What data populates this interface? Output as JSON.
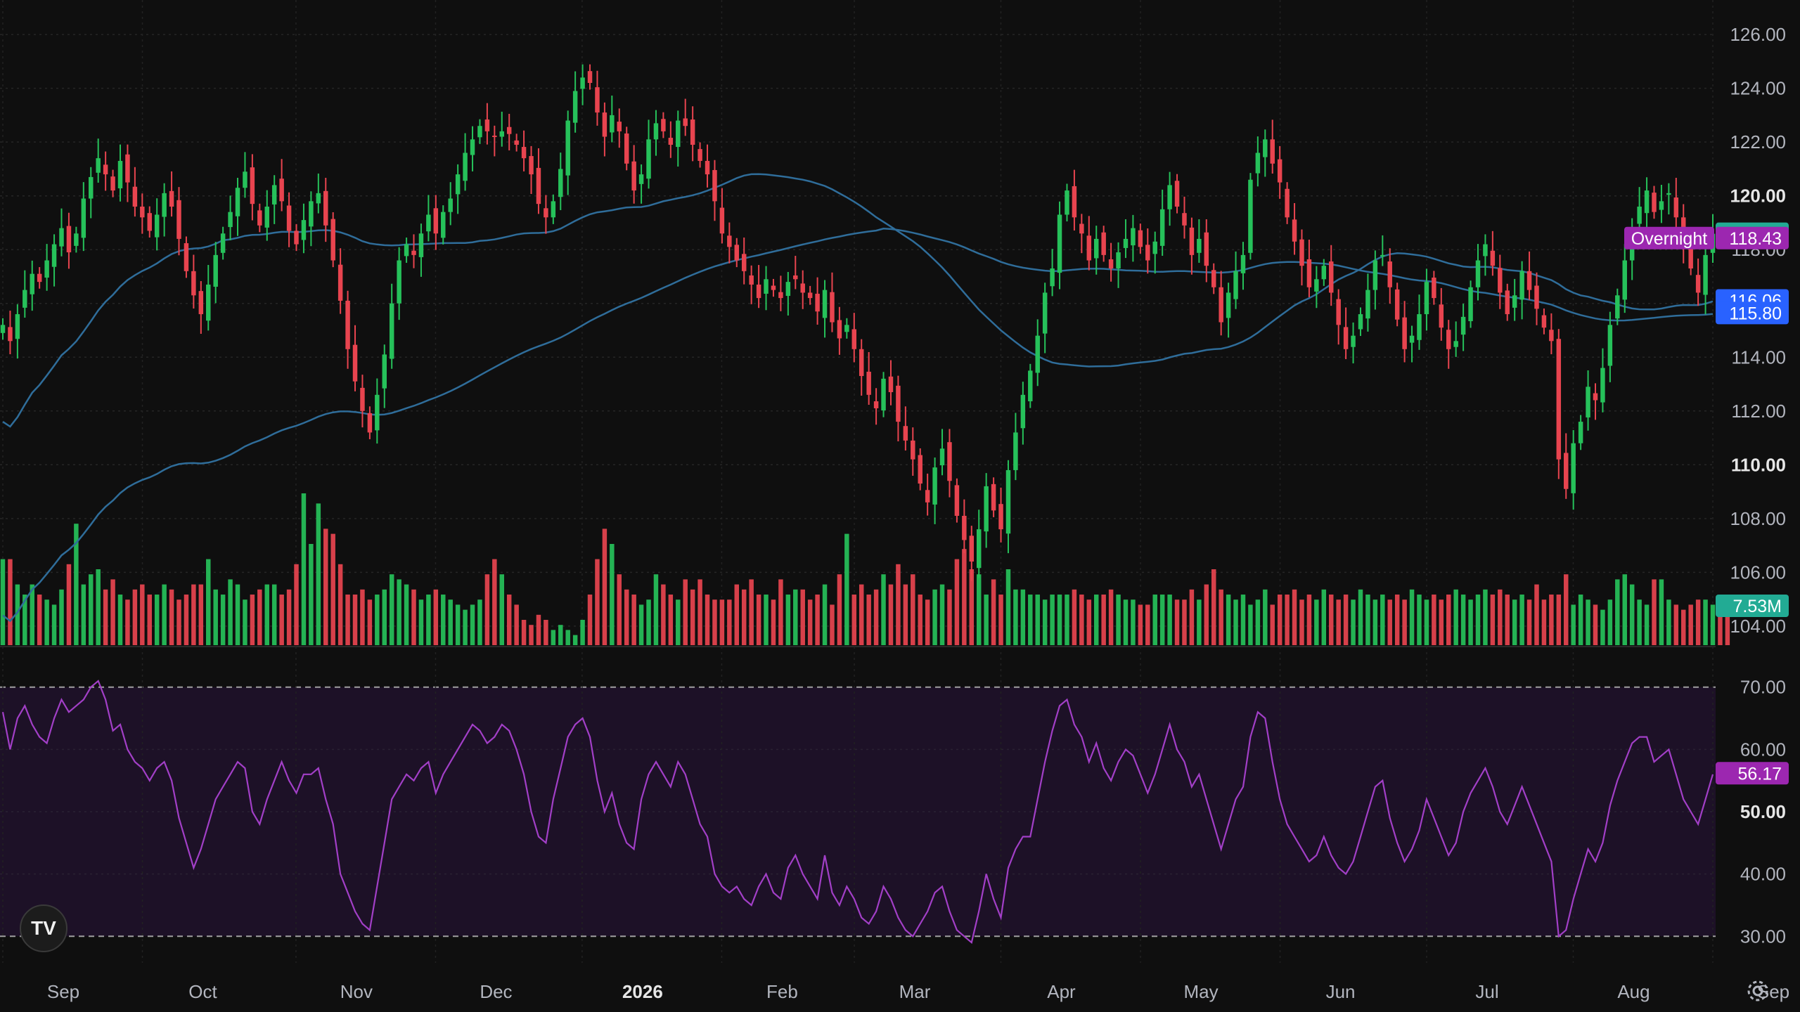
{
  "chart_data": {
    "type": "candlestick",
    "price_axis": {
      "range": [
        103.5,
        126.5
      ],
      "ticks": [
        "126.00",
        "124.00",
        "122.00",
        "120.00",
        "118.00",
        "116.00",
        "114.00",
        "112.00",
        "110.00",
        "108.00",
        "106.00",
        "104.00"
      ],
      "bold_ticks": [
        "120.00",
        "110.00"
      ]
    },
    "rsi_axis": {
      "range": [
        28,
        72
      ],
      "ticks": [
        "70.00",
        "60.00",
        "50.00",
        "40.00",
        "30.00"
      ],
      "bold_ticks": [
        "50.00"
      ],
      "band": [
        30,
        70
      ]
    },
    "time_axis": {
      "labels": [
        {
          "text": "Sep",
          "index": 0
        },
        {
          "text": "Oct",
          "index": 20
        },
        {
          "text": "Nov",
          "index": 42
        },
        {
          "text": "Dec",
          "index": 62
        },
        {
          "text": "2026",
          "index": 83,
          "bold": true
        },
        {
          "text": "Feb",
          "index": 103
        },
        {
          "text": "Mar",
          "index": 122
        },
        {
          "text": "Apr",
          "index": 143
        },
        {
          "text": "May",
          "index": 163
        },
        {
          "text": "Jun",
          "index": 183
        },
        {
          "text": "Jul",
          "index": 204
        },
        {
          "text": "Aug",
          "index": 225
        },
        {
          "text": "Sep",
          "index": 245
        }
      ]
    },
    "price_tags": [
      {
        "text": "118.59",
        "value": 118.59,
        "color": "#22ab94",
        "label": ""
      },
      {
        "text": "118.43",
        "value": 118.43,
        "color": "#9c27b0",
        "label": "Overnight"
      },
      {
        "text": "116.06",
        "value": 116.06,
        "color": "#2962ff",
        "label": ""
      },
      {
        "text": "115.80",
        "value": 115.8,
        "color": "#2962ff",
        "label": ""
      }
    ],
    "volume_tag": {
      "text": "7.53M",
      "color": "#22ab94"
    },
    "rsi_tag": {
      "text": "56.17",
      "value": 56.17,
      "color": "#9c27b0"
    },
    "colors": {
      "up": "#26c15a",
      "down": "#e8444f",
      "ma": "#2f6d9a",
      "rsi": "#a23fc7",
      "rsi_band": "#1d1127"
    },
    "closes": [
      115.2,
      114.6,
      115.6,
      116.5,
      117.1,
      116.8,
      117.6,
      118.2,
      118.8,
      117.9,
      118.6,
      119.9,
      120.7,
      121.4,
      120.8,
      120.2,
      121.3,
      120.5,
      119.6,
      119.2,
      118.7,
      119.3,
      120.1,
      119.6,
      118.4,
      117.2,
      116.3,
      115.6,
      116.7,
      117.8,
      118.6,
      119.4,
      120.3,
      120.9,
      119.7,
      118.9,
      119.6,
      120.4,
      119.8,
      118.7,
      118.2,
      119.1,
      119.8,
      120.1,
      118.9,
      117.6,
      116.1,
      114.3,
      113.1,
      112.0,
      111.2,
      112.6,
      114.1,
      116.0,
      117.6,
      118.2,
      117.8,
      118.6,
      119.3,
      118.6,
      119.4,
      119.9,
      120.8,
      121.6,
      122.1,
      122.6,
      122.4,
      122.2,
      122.4,
      122.3,
      121.9,
      121.4,
      120.8,
      119.7,
      119.2,
      119.8,
      121.0,
      122.8,
      123.9,
      124.4,
      124.2,
      123.1,
      122.2,
      123.0,
      122.4,
      121.2,
      120.2,
      120.8,
      122.1,
      122.7,
      122.4,
      121.9,
      122.8,
      122.6,
      121.9,
      121.3,
      120.8,
      119.8,
      118.6,
      118.1,
      117.6,
      117.2,
      116.7,
      116.2,
      116.9,
      116.5,
      116.2,
      116.8,
      116.9,
      116.4,
      116.2,
      115.7,
      116.5,
      115.3,
      114.7,
      115.2,
      114.3,
      113.3,
      112.6,
      112.1,
      113.2,
      112.7,
      111.6,
      110.9,
      110.2,
      109.3,
      108.6,
      109.9,
      110.6,
      109.4,
      108.1,
      107.2,
      106.4,
      107.6,
      109.2,
      108.3,
      107.6,
      109.8,
      111.2,
      112.6,
      113.5,
      114.8,
      116.4,
      117.3,
      119.3,
      120.2,
      119.2,
      118.6,
      117.6,
      118.4,
      117.8,
      117.3,
      117.9,
      118.4,
      118.8,
      118.1,
      117.6,
      118.3,
      119.5,
      120.4,
      119.6,
      118.9,
      117.8,
      118.4,
      117.4,
      116.6,
      115.3,
      116.4,
      117.2,
      117.8,
      120.6,
      121.6,
      122.1,
      121.2,
      120.5,
      119.2,
      118.3,
      117.4,
      116.6,
      116.9,
      117.4,
      116.4,
      115.2,
      114.3,
      114.8,
      115.6,
      116.5,
      117.6,
      117.8,
      116.6,
      115.4,
      114.3,
      114.8,
      115.6,
      116.8,
      116.2,
      115.1,
      114.3,
      114.6,
      115.5,
      116.6,
      117.6,
      118.2,
      117.4,
      116.4,
      115.6,
      116.3,
      117.2,
      116.5,
      115.8,
      115.1,
      114.6,
      110.2,
      109.1,
      110.8,
      111.6,
      112.9,
      112.4,
      113.6,
      115.2,
      116.3,
      117.6,
      118.8,
      119.6,
      120.2,
      119.4,
      119.8,
      120.1,
      119.2,
      118.1,
      117.3,
      116.4,
      117.8,
      118.59
    ],
    "volumes": [
      17,
      17,
      12,
      10,
      12,
      10,
      9,
      8,
      11,
      16,
      24,
      12,
      14,
      15,
      11,
      13,
      10,
      9,
      11,
      12,
      10,
      10,
      12,
      11,
      9,
      10,
      12,
      12,
      17,
      11,
      10,
      13,
      12,
      9,
      10,
      11,
      12,
      12,
      10,
      11,
      16,
      30,
      20,
      28,
      23,
      22,
      16,
      10,
      10,
      11,
      9,
      10,
      11,
      14,
      13,
      12,
      11,
      9,
      10,
      11,
      10,
      9,
      8,
      7,
      8,
      9,
      14,
      17,
      14,
      10,
      8,
      5,
      4,
      6,
      5,
      3,
      4,
      3,
      2,
      5,
      10,
      17,
      23,
      20,
      14,
      11,
      10,
      8,
      9,
      14,
      12,
      10,
      9,
      13,
      11,
      13,
      10,
      9,
      9,
      9,
      12,
      11,
      13,
      10,
      10,
      9,
      13,
      10,
      11,
      11,
      9,
      10,
      12,
      8,
      14,
      22,
      10,
      12,
      10,
      11,
      14,
      12,
      16,
      12,
      14,
      10,
      9,
      11,
      12,
      11,
      17,
      19,
      15,
      14,
      10,
      13,
      10,
      15,
      11,
      11,
      10,
      10,
      9,
      10,
      10,
      10,
      11,
      10,
      9,
      10,
      10,
      11,
      10,
      9,
      9,
      8,
      8,
      10,
      10,
      10,
      9,
      9,
      11,
      9,
      12,
      15,
      11,
      10,
      9,
      10,
      8,
      9,
      11,
      8,
      10,
      10,
      11,
      9,
      10,
      9,
      11,
      10,
      9,
      10,
      9,
      11,
      10,
      9,
      10,
      9,
      10,
      9,
      11,
      10,
      9,
      10,
      9,
      10,
      11,
      10,
      9,
      10,
      11,
      10,
      11,
      10,
      9,
      10,
      9,
      12,
      9,
      10,
      10,
      14,
      8,
      10,
      9,
      8,
      7,
      9,
      13,
      14,
      12,
      9,
      8,
      13,
      13,
      9,
      8,
      7,
      8,
      9,
      9,
      8,
      9,
      7
    ],
    "rsi": [
      66,
      60,
      65,
      67,
      64,
      62,
      61,
      65,
      68,
      66,
      67,
      68,
      70,
      71,
      68,
      63,
      64,
      60,
      58,
      57,
      55,
      57,
      58,
      55,
      49,
      45,
      41,
      44,
      48,
      52,
      54,
      56,
      58,
      57,
      50,
      48,
      52,
      55,
      58,
      55,
      53,
      56,
      56,
      57,
      52,
      48,
      40,
      37,
      34,
      32,
      31,
      38,
      45,
      52,
      54,
      56,
      55,
      57,
      58,
      53,
      56,
      58,
      60,
      62,
      64,
      63,
      61,
      62,
      64,
      63,
      60,
      56,
      50,
      46,
      45,
      52,
      57,
      62,
      64,
      65,
      62,
      55,
      50,
      53,
      48,
      45,
      44,
      52,
      56,
      58,
      56,
      54,
      58,
      56,
      52,
      48,
      46,
      40,
      38,
      37,
      38,
      36,
      35,
      38,
      40,
      37,
      36,
      41,
      43,
      40,
      38,
      36,
      43,
      37,
      35,
      38,
      36,
      33,
      32,
      34,
      38,
      36,
      33,
      31,
      30,
      32,
      34,
      37,
      38,
      34,
      31,
      30,
      29,
      34,
      40,
      36,
      33,
      41,
      44,
      46,
      46,
      52,
      58,
      63,
      67,
      68,
      64,
      62,
      58,
      61,
      57,
      55,
      58,
      60,
      59,
      56,
      53,
      56,
      60,
      64,
      60,
      58,
      54,
      56,
      52,
      48,
      44,
      48,
      52,
      54,
      62,
      66,
      65,
      58,
      52,
      48,
      46,
      44,
      42,
      43,
      46,
      43,
      41,
      40,
      42,
      46,
      50,
      54,
      55,
      49,
      45,
      42,
      44,
      47,
      52,
      49,
      46,
      43,
      45,
      50,
      53,
      55,
      57,
      54,
      50,
      48,
      51,
      54,
      51,
      48,
      45,
      42,
      30,
      31,
      36,
      40,
      44,
      42,
      45,
      51,
      55,
      58,
      61,
      62,
      62,
      58,
      59,
      60,
      56,
      52,
      50,
      48,
      52,
      56
    ]
  }
}
